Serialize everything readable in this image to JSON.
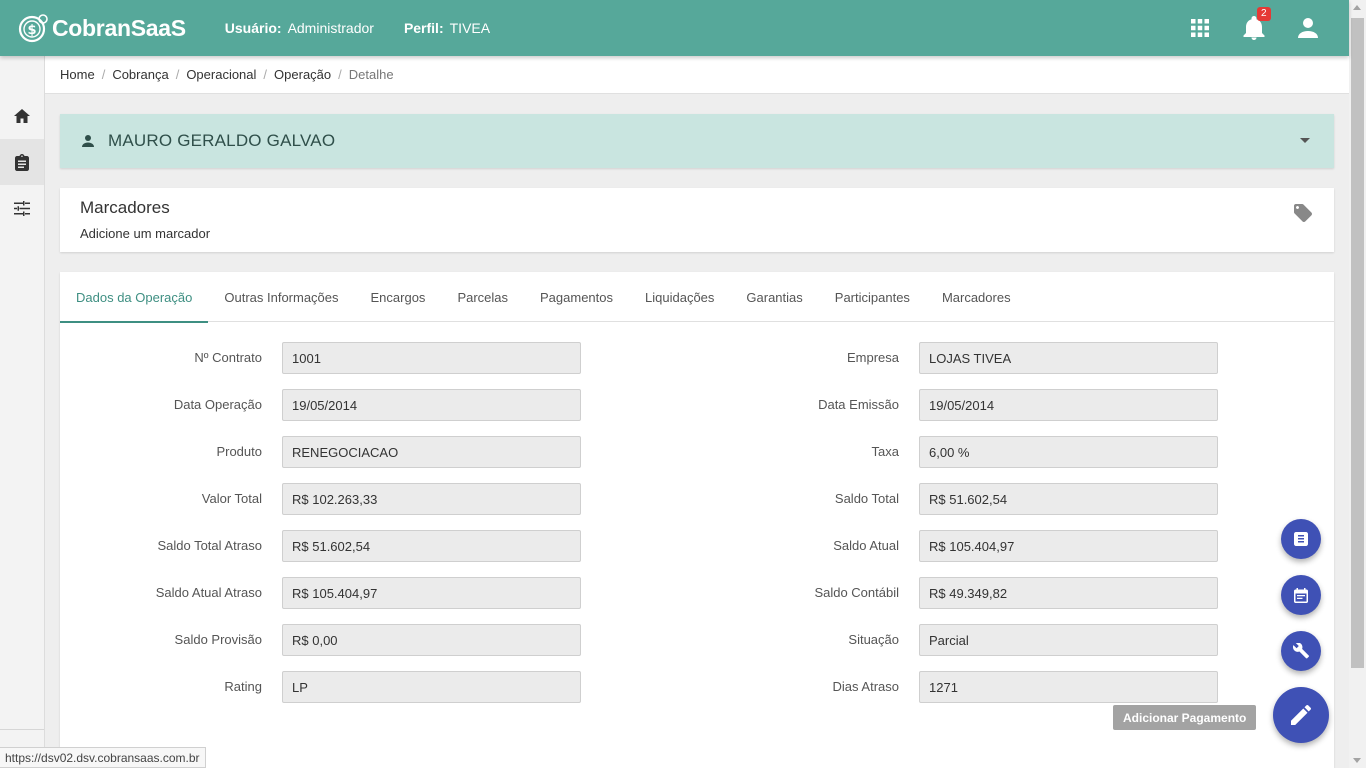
{
  "header": {
    "brand": "CobranSaaS",
    "user_label": "Usuário:",
    "user_value": "Administrador",
    "profile_label": "Perfil:",
    "profile_value": "TIVEA",
    "notification_count": "2",
    "bg_color": "#56a89a"
  },
  "sidebar": {
    "items": [
      {
        "icon": "home-icon"
      },
      {
        "icon": "clipboard-icon",
        "active": true
      },
      {
        "icon": "sliders-icon"
      }
    ]
  },
  "breadcrumb": [
    "Home",
    "Cobrança",
    "Operacional",
    "Operação",
    "Detalhe"
  ],
  "client": {
    "name": "MAURO GERALDO GALVAO"
  },
  "markers": {
    "title": "Marcadores",
    "add_text": "Adicione um marcador"
  },
  "tabs": [
    "Dados da Operação",
    "Outras Informações",
    "Encargos",
    "Parcelas",
    "Pagamentos",
    "Liquidações",
    "Garantias",
    "Participantes",
    "Marcadores"
  ],
  "fields_left": [
    {
      "label": "Nº Contrato",
      "value": "1001"
    },
    {
      "label": "Data Operação",
      "value": "19/05/2014"
    },
    {
      "label": "Produto",
      "value": "RENEGOCIACAO"
    },
    {
      "label": "Valor Total",
      "value": "R$ 102.263,33"
    },
    {
      "label": "Saldo Total Atraso",
      "value": "R$ 51.602,54"
    },
    {
      "label": "Saldo Atual Atraso",
      "value": "R$ 105.404,97"
    },
    {
      "label": "Saldo Provisão",
      "value": "R$ 0,00"
    },
    {
      "label": "Rating",
      "value": "LP"
    }
  ],
  "fields_right": [
    {
      "label": "Empresa",
      "value": "LOJAS TIVEA"
    },
    {
      "label": "Data Emissão",
      "value": "19/05/2014"
    },
    {
      "label": "Taxa",
      "value": "6,00 %"
    },
    {
      "label": "Saldo Total",
      "value": "R$ 51.602,54"
    },
    {
      "label": "Saldo Atual",
      "value": "R$ 105.404,97"
    },
    {
      "label": "Saldo Contábil",
      "value": "R$ 49.349,82"
    },
    {
      "label": "Situação",
      "value": "Parcial"
    },
    {
      "label": "Dias Atraso",
      "value": "1271"
    }
  ],
  "fab": {
    "tooltip": "Adicionar Pagamento",
    "color": "#3f51b5"
  },
  "status_url": "https://dsv02.dsv.cobransaas.com.br"
}
